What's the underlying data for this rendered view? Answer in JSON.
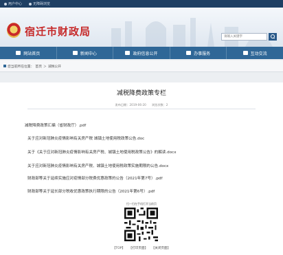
{
  "topbar": {
    "items": [
      "用户中心",
      "无障碍浏览"
    ]
  },
  "header": {
    "site_title": "宿迁市财政局",
    "search_placeholder": "请输入关键字"
  },
  "nav": {
    "items": [
      {
        "label": "网站首页",
        "icon": "home-icon"
      },
      {
        "label": "新闻中心",
        "icon": "news-icon"
      },
      {
        "label": "政府信息公开",
        "icon": "info-icon"
      },
      {
        "label": "办事服务",
        "icon": "service-icon"
      },
      {
        "label": "互动交流",
        "icon": "chat-icon"
      }
    ]
  },
  "breadcrumb": {
    "location": "您当前所在位置：",
    "home": "首页",
    "sep1": "＞",
    "section": "减税公开"
  },
  "article": {
    "title": "减税降费政策专栏",
    "published": "发布日期：2019-06-20",
    "views": "浏览次数：2",
    "docs": [
      "减税降费政策汇编（省财政厅）.pdf",
      "关于应对新冠肺炎疫情影响有关房产税  城镇土地使用税政策公告.doc",
      "关于《关于应对新冠肺炎疫情影响有关房产税、城镇土地使用税政策公告》的解读.docx",
      "关于应对新冠肺炎疫情影响有关房产税、城镇土地使用税政策实施期限的公告.docx",
      "财政部等关于延续实施应对疫情部分税费优惠政策的公告（2021年第7号）.pdf",
      "财政部等关于延长部分税收优惠政策执行期限的公告（2021年第6号）.pdf"
    ]
  },
  "qr": {
    "label": "扫一扫在手机打开当前页"
  },
  "footer": {
    "top": "【TOP】",
    "print": "【打印页面】",
    "close": "【关闭页面】"
  },
  "colors": {
    "topbar": "#1f3f63",
    "nav": "#2f6797",
    "title_red": "#c62828"
  }
}
